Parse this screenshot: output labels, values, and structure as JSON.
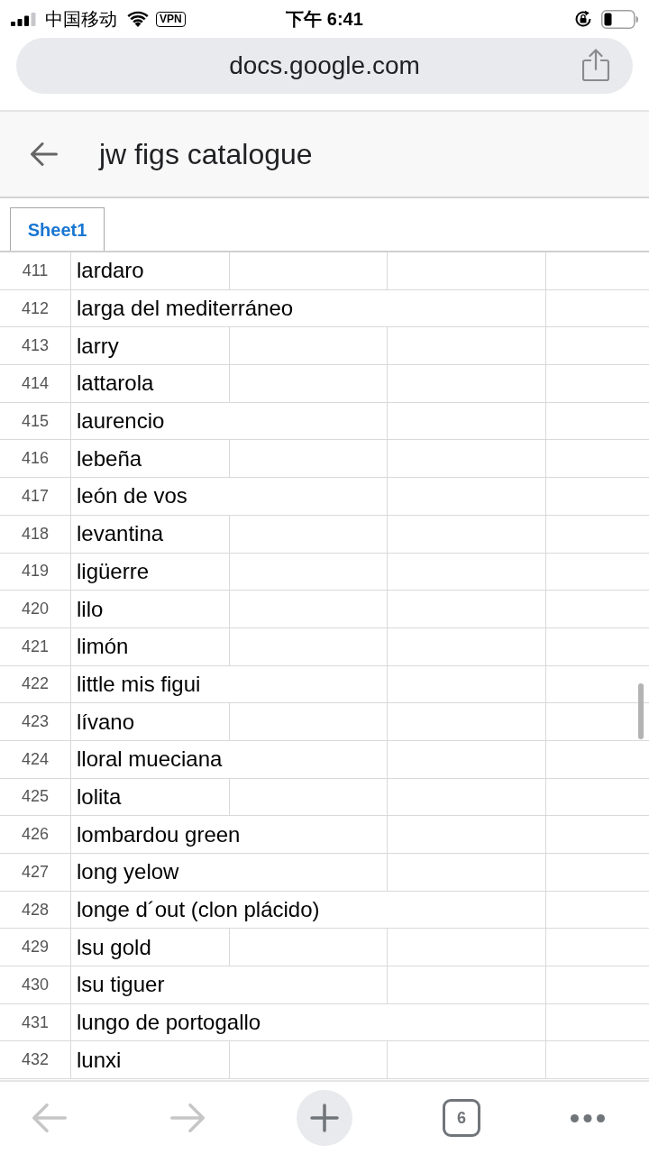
{
  "status_bar": {
    "carrier": "中国移动",
    "vpn": "VPN",
    "time": "下午 6:41"
  },
  "address_bar": {
    "url": "docs.google.com"
  },
  "header": {
    "title": "jw figs catalogue"
  },
  "sheet_tabs": [
    {
      "label": "Sheet1",
      "selected": true
    }
  ],
  "rows": [
    {
      "number": "411",
      "column_1": "lardaro"
    },
    {
      "number": "412",
      "column_1": "larga del mediterráneo"
    },
    {
      "number": "413",
      "column_1": "larry"
    },
    {
      "number": "414",
      "column_1": "lattarola"
    },
    {
      "number": "415",
      "column_1": "laurencio"
    },
    {
      "number": "416",
      "column_1": "lebeña"
    },
    {
      "number": "417",
      "column_1": "león de vos"
    },
    {
      "number": "418",
      "column_1": "levantina"
    },
    {
      "number": "419",
      "column_1": "ligüerre"
    },
    {
      "number": "420",
      "column_1": "lilo"
    },
    {
      "number": "421",
      "column_1": "limón"
    },
    {
      "number": "422",
      "column_1": "little mis figui"
    },
    {
      "number": "423",
      "column_1": "lívano"
    },
    {
      "number": "424",
      "column_1": "lloral mueciana"
    },
    {
      "number": "425",
      "column_1": "lolita"
    },
    {
      "number": "426",
      "column_1": "lombardou green"
    },
    {
      "number": "427",
      "column_1": "long yelow"
    },
    {
      "number": "428",
      "column_1": "longe d´out (clon plácido)"
    },
    {
      "number": "429",
      "column_1": "lsu gold"
    },
    {
      "number": "430",
      "column_1": "lsu tiguer"
    },
    {
      "number": "431",
      "column_1": "lungo de portogallo"
    },
    {
      "number": "432",
      "column_1": "lunxi"
    }
  ],
  "toolbar": {
    "back": {
      "disabled": true
    },
    "forward": {
      "disabled": true
    },
    "tab_count": "6"
  }
}
